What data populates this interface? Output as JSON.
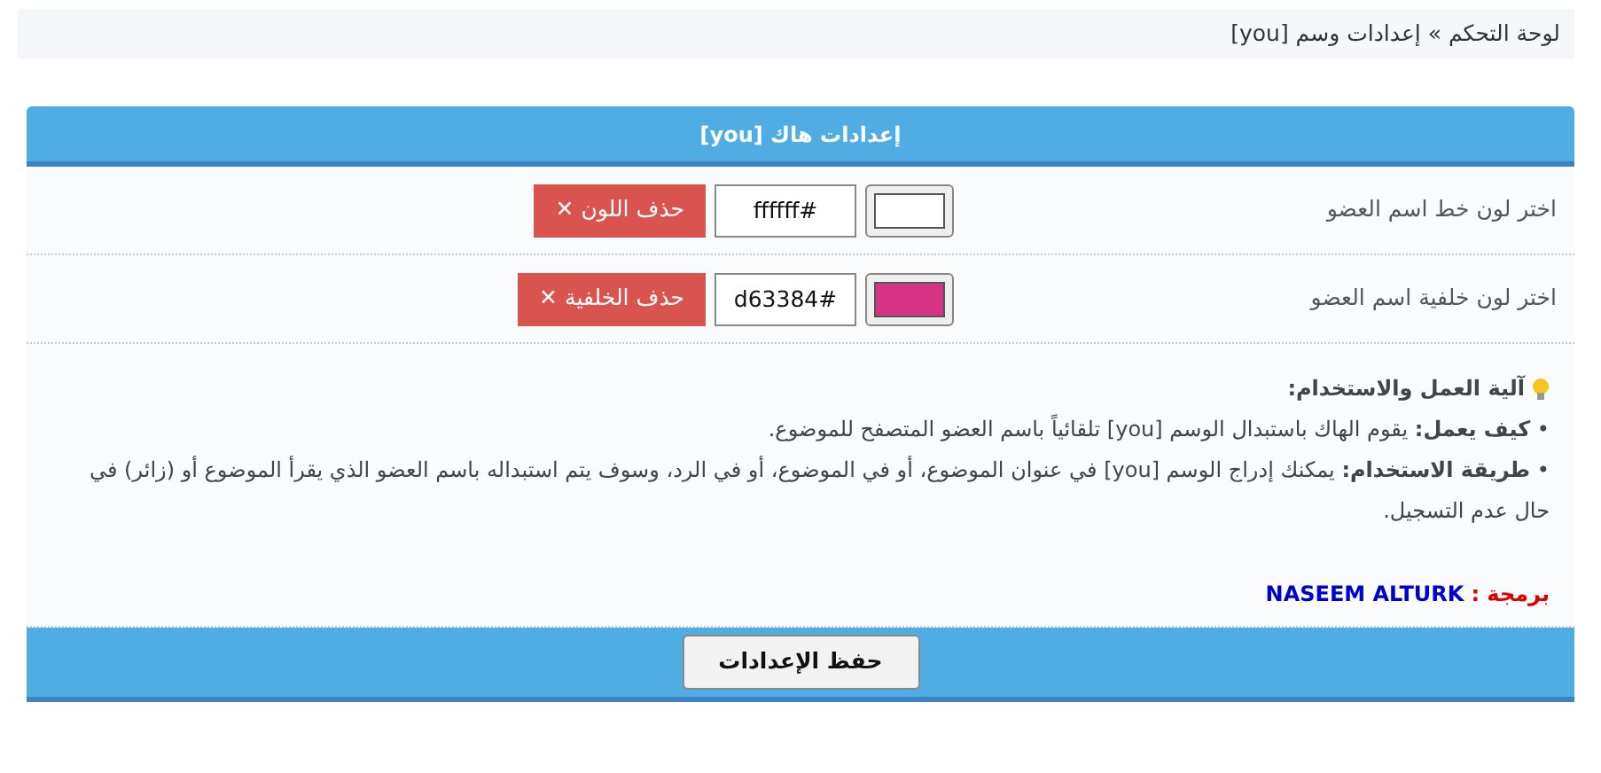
{
  "breadcrumb": "لوحة التحكم » إعدادات وسم [you]",
  "panel": {
    "title": "إعدادات هاك [you]"
  },
  "color_rows": [
    {
      "label": "اختر لون خط اسم العضو",
      "color": "#ffffff",
      "value": "ffffff#",
      "delete_label": "حذف اللون ✕"
    },
    {
      "label": "اختر لون خلفية اسم العضو",
      "color": "#d63384",
      "value": "d63384#",
      "delete_label": "حذف الخلفية ✕"
    }
  ],
  "info": {
    "title": "آلية العمل والاستخدام:",
    "lines": [
      "• **كيف يعمل:** يقوم الهاك باستبدال الوسم [you] تلقائياً باسم العضو المتصفح للموضوع.",
      "• **طريقة الاستخدام:** يمكنك إدراج الوسم [you] في عنوان الموضوع، أو في الموضوع، أو في الرد، وسوف يتم استبداله باسم العضو الذي يقرأ الموضوع أو (زائر) في حال عدم التسجيل."
    ]
  },
  "credit": {
    "label": "برمجة :",
    "author": "NASEEM ALTURK"
  },
  "save_button": "حفظ الإعدادات"
}
